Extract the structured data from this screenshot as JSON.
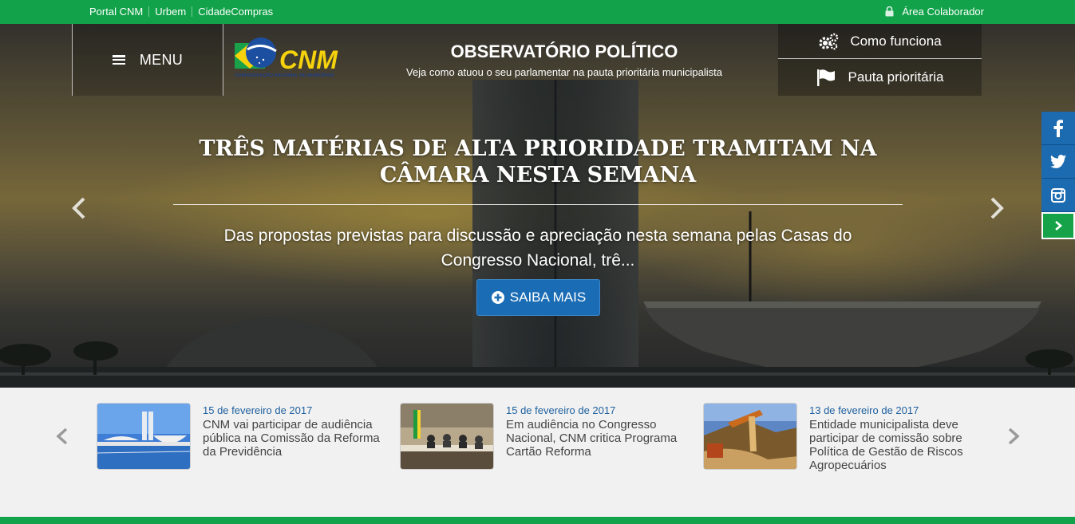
{
  "topbar": {
    "links": [
      "Portal CNM",
      "Urbem",
      "CidadeCompras"
    ],
    "collaborator_label": "Área Colaborador",
    "color": "#12a24a"
  },
  "header": {
    "menu_label": "MENU",
    "logo_text": "CNM",
    "logo_subtitle": "CONFEDERAÇÃO NACIONAL DE MUNICÍPIOS",
    "title": "OBSERVATÓRIO POLÍTICO",
    "subtitle": "Veja como atuou o seu parlamentar na pauta prioritária municipalista",
    "buttons": [
      {
        "label": "Como funciona",
        "icon": "gears-icon"
      },
      {
        "label": "Pauta prioritária",
        "icon": "flag-icon"
      }
    ]
  },
  "hero": {
    "headline": "TRÊS MATÉRIAS DE ALTA PRIORIDADE TRAMITAM NA CÂMARA NESTA SEMANA",
    "summary": "Das propostas previstas para discussão e apreciação nesta semana pelas Casas do Congresso Nacional, trê...",
    "cta_label": "SAIBA MAIS",
    "cta_color": "#1a6cb5"
  },
  "social": [
    "facebook-icon",
    "twitter-icon",
    "instagram-icon",
    "chevron-right-icon"
  ],
  "news": [
    {
      "date": "15 de fevereiro de 2017",
      "title": "CNM vai participar de audiência pública na Comissão da Reforma da Previdência"
    },
    {
      "date": "15 de fevereiro de 2017",
      "title": "Em audiência no Congresso Nacional, CNM critica Programa Cartão Reforma"
    },
    {
      "date": "13 de fevereiro de 2017",
      "title": "Entidade municipalista deve participar de comissão sobre Política de Gestão de Riscos Agropecuários"
    }
  ]
}
